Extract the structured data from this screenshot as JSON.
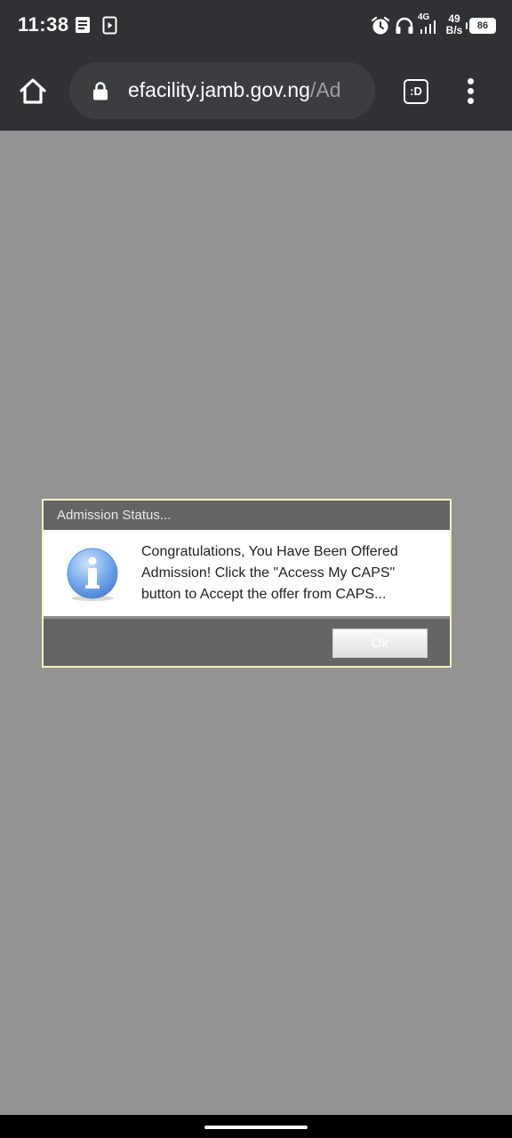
{
  "status_bar": {
    "time": "11:38",
    "network": "4G",
    "speed_value": "49",
    "speed_unit": "B/s",
    "battery": "86",
    "icons": [
      "notes-icon",
      "media-icon",
      "alarm-icon",
      "headphones-icon",
      "signal-icon",
      "battery-icon"
    ]
  },
  "browser": {
    "url_host": "efacility.jamb.gov.ng",
    "url_path": "/Ad",
    "tab_label": ":D",
    "icons": [
      "home-icon",
      "lock-icon",
      "tab-switcher-icon",
      "more-menu-icon"
    ]
  },
  "dialog": {
    "title": "Admission Status...",
    "message": "Congratulations, You Have Been Offered Admission! Click the \"Access My CAPS\" button to Accept the offer from CAPS...",
    "ok_label": "Ok",
    "icon": "info-icon"
  },
  "colors": {
    "page_background": "#939393",
    "browser_chrome": "#303134",
    "dialog_header": "#656565",
    "dialog_border": "#f4f0c0"
  }
}
